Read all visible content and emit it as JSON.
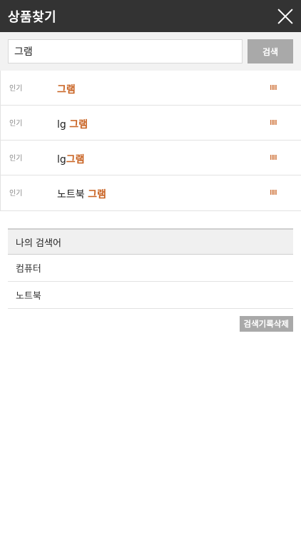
{
  "header": {
    "title": "상품찾기",
    "close_icon": "close-icon"
  },
  "search": {
    "value": "그램",
    "button_label": "검색"
  },
  "suggestions": [
    {
      "tag": "인기",
      "prefix": "",
      "highlight": "그램",
      "bars": "IIIII"
    },
    {
      "tag": "인기",
      "prefix": "lg ",
      "highlight": "그램",
      "bars": "IIIII"
    },
    {
      "tag": "인기",
      "prefix": "lg",
      "highlight": "그램",
      "bars": "IIIII"
    },
    {
      "tag": "인기",
      "prefix": "노트북 ",
      "highlight": "그램",
      "bars": "IIIII"
    }
  ],
  "history": {
    "title": "나의 검색어",
    "items": [
      "컴퓨터",
      "노트북"
    ],
    "delete_label": "검색기록삭제"
  },
  "colors": {
    "header_bg": "#333333",
    "highlight": "#c8601f",
    "button_bg": "#a9a9a9"
  }
}
